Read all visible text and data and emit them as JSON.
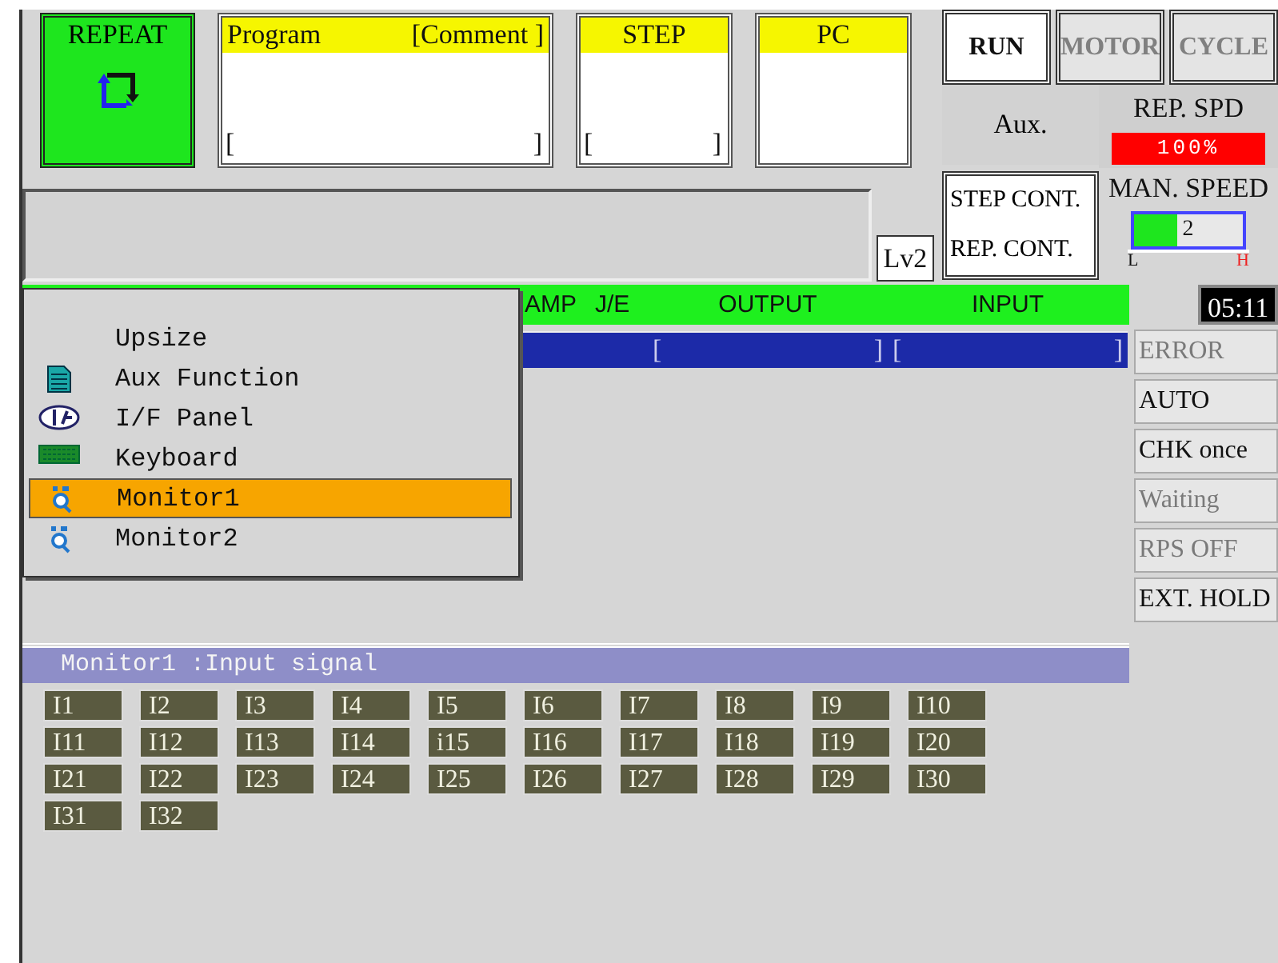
{
  "mode_button": {
    "label": "REPEAT"
  },
  "program_box": {
    "title": "Program",
    "comment": "[Comment ]",
    "open_bracket": "[",
    "close_bracket": "]"
  },
  "step_box": {
    "title": "STEP",
    "open_bracket": "[",
    "close_bracket": "]"
  },
  "pc_box": {
    "title": "PC"
  },
  "state_buttons": [
    {
      "label": "RUN",
      "disabled": false
    },
    {
      "label": "MOTOR",
      "disabled": true
    },
    {
      "label": "CYCLE",
      "disabled": true
    }
  ],
  "aux_button": {
    "label": "Aux."
  },
  "rep_speed": {
    "label": "REP. SPD",
    "value": "100%"
  },
  "continuation": {
    "step_label": "STEP CONT.",
    "rep_label": "REP. CONT."
  },
  "level_badge": "Lv2",
  "man_speed": {
    "label": "MAN. SPEED",
    "value": "2",
    "level": 0.4,
    "low": "L",
    "high": "H"
  },
  "table": {
    "columns": [
      "AMP",
      "J/E",
      "OUTPUT",
      "INPUT"
    ],
    "row": {
      "output_open": "[",
      "output_close": "]",
      "input_open": "[",
      "input_close": "]"
    }
  },
  "clock": "05:11",
  "status": [
    {
      "label": "ERROR",
      "disabled": true
    },
    {
      "label": "AUTO",
      "disabled": false
    },
    {
      "label": "CHK once",
      "disabled": false
    },
    {
      "label": "Waiting",
      "disabled": true
    },
    {
      "label": "RPS OFF",
      "disabled": true
    },
    {
      "label": "EXT. HOLD",
      "disabled": false
    }
  ],
  "menu": {
    "items": [
      {
        "label": "Upsize",
        "kind": "plain",
        "selected": false
      },
      {
        "label": "Aux Function",
        "kind": "document",
        "selected": false
      },
      {
        "label": "I/F Panel",
        "kind": "interface",
        "selected": false
      },
      {
        "label": "Keyboard",
        "kind": "keyboard",
        "selected": false
      },
      {
        "label": "Monitor1",
        "kind": "monitor",
        "selected": true
      },
      {
        "label": "Monitor2",
        "kind": "monitor",
        "selected": false
      }
    ]
  },
  "monitor": {
    "title": "Monitor1 :Input signal",
    "signals": [
      "I1",
      "I2",
      "I3",
      "I4",
      "I5",
      "I6",
      "I7",
      "I8",
      "I9",
      "I10",
      "I11",
      "I12",
      "I13",
      "I14",
      "i15",
      "I16",
      "I17",
      "I18",
      "I19",
      "I20",
      "I21",
      "I22",
      "I23",
      "I24",
      "I25",
      "I26",
      "I27",
      "I28",
      "I29",
      "I30",
      "I31",
      "I32"
    ]
  }
}
